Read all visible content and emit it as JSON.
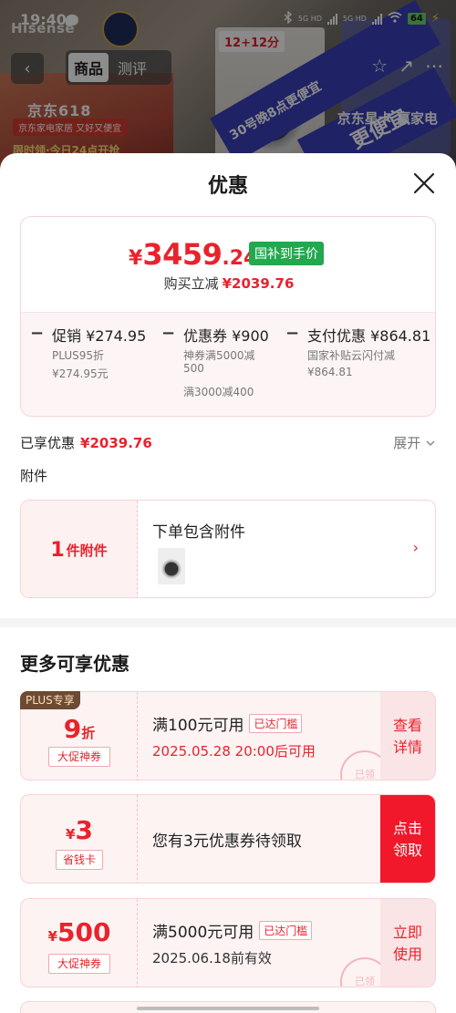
{
  "status": {
    "time": "19:40",
    "net1": "5G HD",
    "net2": "5G HD",
    "battery": "64"
  },
  "background": {
    "brand": "Hisense",
    "jd": "京东618",
    "jd_sub": "京东家电家居 又好又便宜",
    "jd_sub2": "限时领·今日24点开抢",
    "price_tag": "12+12分",
    "banner": "30号晚8点更便宜",
    "banner2": "更便宜",
    "right_text": "京东星卡 赢家电",
    "right_badge": "5+"
  },
  "nav": {
    "back": "‹",
    "tabs": [
      "商品",
      "测评"
    ],
    "active_tab": 0
  },
  "sheet": {
    "title": "优惠",
    "summary": {
      "price_yen": "¥",
      "price_int": "3459",
      "price_dec": ".24",
      "subsidy_tag": "国补到手价",
      "reduce_label": "购买立减",
      "reduce_amount": "¥2039.76",
      "breakdown": [
        {
          "head": "促销 ¥274.95",
          "lines": [
            "PLUS95折",
            "¥274.95元"
          ]
        },
        {
          "head": "优惠券 ¥900",
          "lines": [
            "神券满5000减",
            "500",
            "满3000减400"
          ]
        },
        {
          "head": "支付优惠 ¥864.81",
          "lines": [
            "国家补贴云闪付减",
            "¥864.81"
          ]
        }
      ]
    },
    "enjoyed_label": "已享优惠",
    "enjoyed_amount": "¥2039.76",
    "expand_label": "展开",
    "attach_label": "附件",
    "attachment": {
      "count": "1",
      "unit": "件附件",
      "text": "下单包含附件",
      "arrow": "›"
    },
    "more_title": "更多可享优惠",
    "coupons": [
      {
        "tag": "PLUS专享",
        "value_main": "9",
        "value_unit": "折",
        "type": "大促神券",
        "main": "满100元可用",
        "badge": "已达门槛",
        "note": "2025.05.28 20:00后可用",
        "note_color": "#e8232c",
        "action": "查看详情",
        "stamp": "已领"
      },
      {
        "value_prefix": "¥",
        "value_main": "3",
        "type": "省钱卡",
        "main": "您有3元优惠券待领取",
        "action": "点击领取"
      },
      {
        "value_prefix": "¥",
        "value_main": "500",
        "type": "大促神券",
        "main": "满5000元可用",
        "badge": "已达门槛",
        "note": "2025.06.18前有效",
        "note_color": "#333333",
        "action": "立即使用",
        "stamp": "已领"
      }
    ]
  }
}
